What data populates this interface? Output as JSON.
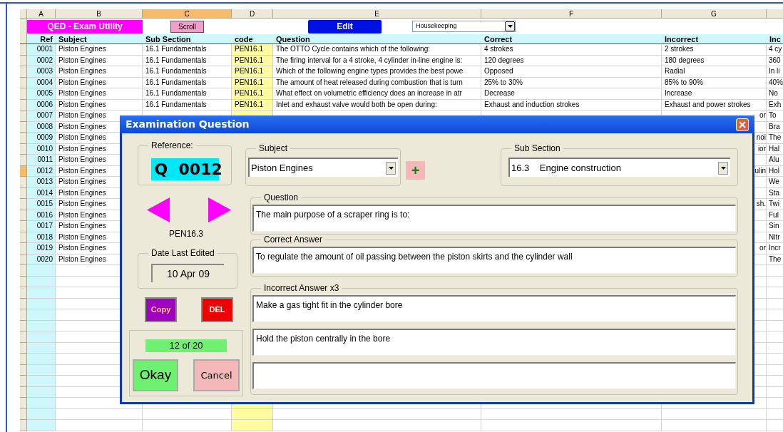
{
  "sheet": {
    "columns": [
      {
        "label": "A",
        "selected": false
      },
      {
        "label": "B",
        "selected": false
      },
      {
        "label": "C",
        "selected": true
      },
      {
        "label": "D",
        "selected": false
      },
      {
        "label": "E",
        "selected": false
      },
      {
        "label": "F",
        "selected": false
      },
      {
        "label": "G",
        "selected": false
      }
    ],
    "toolbar": {
      "title": "QED - Exam Utility",
      "scroll_button": "Scroll",
      "edit_button": "Edit",
      "dropdown": "Housekeeping"
    },
    "headers": [
      "Ref",
      "Subject",
      "Sub Section",
      "code",
      "Question",
      "Correct",
      "Incorrect",
      "Inc"
    ],
    "rows": [
      {
        "selected": false,
        "ref": "0001",
        "subject": "Piston Engines",
        "sub_section": "16.1   Fundamentals",
        "code": "PEN16.1",
        "question": "The OTTO Cycle contains which of the following:",
        "correct": "4 strokes",
        "incorrect": "2 strokes",
        "column_8": "4 cy"
      },
      {
        "selected": false,
        "ref": "0002",
        "subject": "Piston Engines",
        "sub_section": "16.1   Fundamentals",
        "code": "PEN16.1",
        "question": "The firing interval for a 4 stroke, 4 cylinder in-line engine is:",
        "correct": "120 degrees",
        "incorrect": "180 degrees",
        "column_8": "360"
      },
      {
        "selected": false,
        "ref": "0003",
        "subject": "Piston Engines",
        "sub_section": "16.1   Fundamentals",
        "code": "PEN16.1",
        "question": "Which of the following engine types provides the best powe",
        "correct": "Opposed",
        "incorrect": "Radial",
        "column_8": "In li"
      },
      {
        "selected": false,
        "ref": "0004",
        "subject": "Piston Engines",
        "sub_section": "16.1   Fundamentals",
        "code": "PEN16.1",
        "question": "The amount of heat released during combustion that is turn",
        "correct": "25% to 30%",
        "incorrect": "85% to 90%",
        "column_8": "40%"
      },
      {
        "selected": false,
        "ref": "0005",
        "subject": "Piston Engines",
        "sub_section": "16.1   Fundamentals",
        "code": "PEN16.1",
        "question": "What effect on volumetric efficiency does an increase in atr",
        "correct": "Decrease",
        "incorrect": "Increase",
        "column_8": "No"
      },
      {
        "selected": false,
        "ref": "0006",
        "subject": "Piston Engines",
        "sub_section": "16.1   Fundamentals",
        "code": "PEN16.1",
        "question": "Inlet and exhaust valve would both be open during:",
        "correct": "Exhaust and induction strokes",
        "incorrect": "Exhaust and power strokes",
        "column_8": "Exh"
      },
      {
        "selected": false,
        "ref": "0007",
        "subject": "Piston Engines",
        "incorrect": "or",
        "column_8": "To"
      },
      {
        "selected": false,
        "ref": "0008",
        "subject": "Piston Engines",
        "column_8": "Bra"
      },
      {
        "selected": false,
        "ref": "0009",
        "subject": "Piston Engines",
        "incorrect": "noi",
        "column_8": "The"
      },
      {
        "selected": false,
        "ref": "0010",
        "subject": "Piston Engines",
        "incorrect": "ior",
        "column_8": "Hal"
      },
      {
        "selected": false,
        "ref": "0011",
        "subject": "Piston Engines",
        "column_8": "Alu"
      },
      {
        "selected": true,
        "ref": "0012",
        "subject": "Piston Engines",
        "incorrect": "ulin",
        "column_8": "Hol"
      },
      {
        "selected": false,
        "ref": "0013",
        "subject": "Piston Engines",
        "column_8": "We"
      },
      {
        "selected": false,
        "ref": "0014",
        "subject": "Piston Engines",
        "column_8": "Sta"
      },
      {
        "selected": false,
        "ref": "0015",
        "subject": "Piston Engines",
        "incorrect": "sh.",
        "column_8": "Twi"
      },
      {
        "selected": false,
        "ref": "0016",
        "subject": "Piston Engines",
        "column_8": "Ful"
      },
      {
        "selected": false,
        "ref": "0017",
        "subject": "Piston Engines",
        "column_8": "Sin"
      },
      {
        "selected": false,
        "ref": "0018",
        "subject": "Piston Engines",
        "column_8": "Nitr"
      },
      {
        "selected": false,
        "ref": "0019",
        "subject": "Piston Engines",
        "incorrect": "or",
        "column_8": "Incr"
      },
      {
        "selected": false,
        "ref": "0020",
        "subject": "Piston Engines",
        "column_8": "The"
      }
    ]
  },
  "dialog": {
    "title": "Examination Question",
    "reference_label": "Reference:",
    "reference": "Q  0012",
    "code": "PEN16.3",
    "date_label": "Date Last Edited",
    "date": "10 Apr 09",
    "copy_button": "Copy",
    "delete_button": "DEL",
    "counter": "12 of 20",
    "okay_button": "Okay",
    "cancel_button": "Cancel",
    "subject_label": "Subject",
    "subject": "Piston Engines",
    "add_button": "+",
    "sub_section_label": "Sub Section",
    "sub_section": "16.3    Engine construction",
    "question_label": "Question",
    "question": "The main purpose of a scraper ring is to:",
    "correct_label": "Correct Answer",
    "correct": "To regulate the amount of oil passing between the piston skirts and the cylinder wall",
    "incorrect_label": "Incorrect Answer x3",
    "incorrect": [
      "Make a gas tight fit in the cylinder bore",
      "Hold the piston centrally in the bore"
    ]
  }
}
